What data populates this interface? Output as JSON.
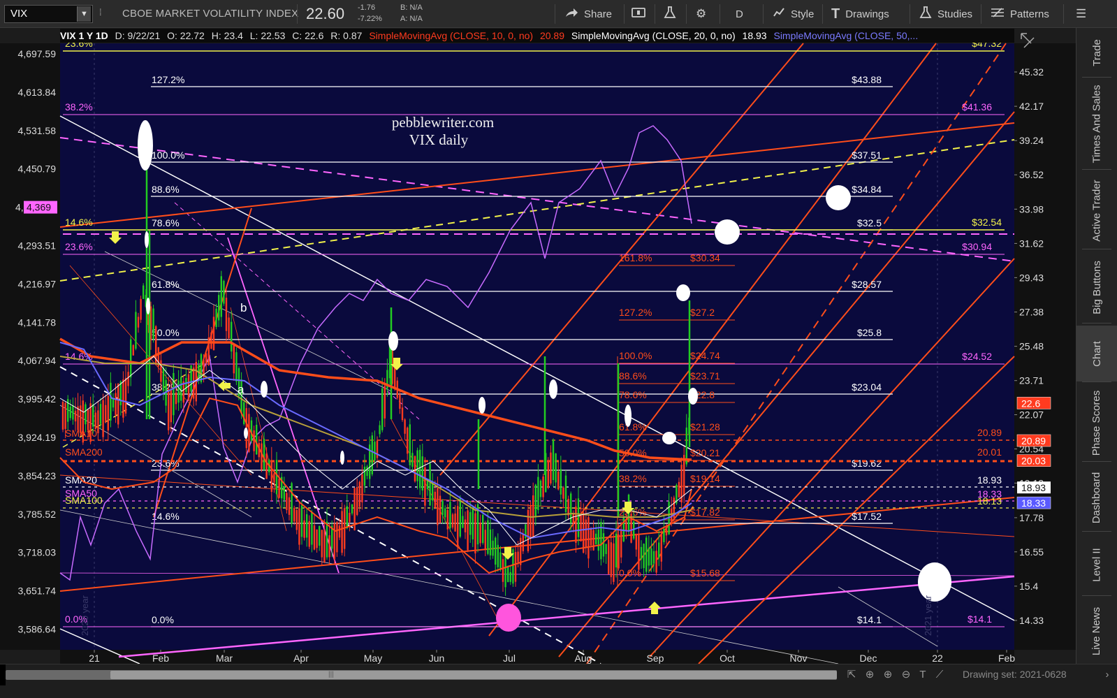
{
  "toolbar": {
    "symbol": "VIX",
    "title": "CBOE MARKET VOLATILITY INDEX",
    "price": "22.60",
    "change_abs": "-1.76",
    "change_pct": "-7.22%",
    "bid": "B: N/A",
    "ask": "A: N/A",
    "share_label": "Share",
    "period_label": "D",
    "style_label": "Style",
    "drawings_label": "Drawings",
    "studies_label": "Studies",
    "patterns_label": "Patterns"
  },
  "header": {
    "symbol_period": "VIX 1 Y 1D",
    "date": "D: 9/22/21",
    "open": "O: 22.72",
    "high": "H: 23.4",
    "low": "L: 22.53",
    "close": "C: 22.6",
    "range": "R: 0.87",
    "sma10_label": "SimpleMovingAvg (CLOSE, 10, 0, no)",
    "sma10_value": "20.89",
    "sma20_label": "SimpleMovingAvg (CLOSE, 20, 0, no)",
    "sma20_value": "18.93",
    "sma50_label": "SimpleMovingAvg (CLOSE, 50,..."
  },
  "colors": {
    "bg": "#0a0a3d",
    "orange": "#ff4d1a",
    "white": "#ffffff",
    "magenta": "#ff66ff",
    "yellow": "#f2f24a",
    "blue_sma50": "#6a6aff",
    "olive_sma100": "#b8a03a",
    "green": "#22cc22",
    "red": "#ff3b1f"
  },
  "left_axis": {
    "ticks": [
      "4,697.59",
      "4,613.84",
      "4,531.58",
      "4,450.79",
      "4,369",
      "4,293.51",
      "4,216.97",
      "4,141.78",
      "4,067.94",
      "3,995.42",
      "3,924.19",
      "3,854.23",
      "3,785.52",
      "3,718.03",
      "3,651.74",
      "3,586.64"
    ],
    "spx_tag_prefix": "4,",
    "spx_tag_value": "4,369"
  },
  "right_axis": {
    "ticks": [
      "45.32",
      "42.17",
      "39.24",
      "36.52",
      "33.98",
      "31.62",
      "29.43",
      "27.38",
      "25.48",
      "23.71",
      "22.07",
      "20.54",
      "19.12",
      "17.78",
      "16.55",
      "15.4",
      "14.33"
    ],
    "tag_close": "22.6",
    "tag_sma10": "20.89",
    "tag_sma200": "20.03",
    "tag_sma20": "18.93",
    "tag_sma50": "18.33"
  },
  "x_axis": {
    "labels": [
      "21",
      "Feb",
      "Mar",
      "Apr",
      "May",
      "Jun",
      "Jul",
      "Aug",
      "Sep",
      "Oct",
      "Nov",
      "Dec",
      "22",
      "Feb"
    ]
  },
  "annotations": {
    "watermark_line1": "pebblewriter.com",
    "watermark_line2": "VIX daily",
    "wave_b": "b",
    "wave_a": "a",
    "year_label_left": "2020 year",
    "year_label_right": "2021 year"
  },
  "fib_white": [
    {
      "pct": "127.2%",
      "value": "$43.88"
    },
    {
      "pct": "100.0%",
      "value": "$37.51"
    },
    {
      "pct": "88.6%",
      "value": "$34.84"
    },
    {
      "pct": "78.6%",
      "value": "$32.5"
    },
    {
      "pct": "61.8%",
      "value": "$28.57"
    },
    {
      "pct": "50.0%",
      "value": "$25.8"
    },
    {
      "pct": "38.2%",
      "value": "$23.04"
    },
    {
      "pct": "23.6%",
      "value": "$19.62"
    },
    {
      "pct": "14.6%",
      "value": "$17.52"
    },
    {
      "pct": "0.0%",
      "value": "$14.1"
    }
  ],
  "fib_magenta": [
    {
      "pct": "38.2%",
      "value": "$41.36"
    },
    {
      "pct": "23.6%",
      "value": "$30.94"
    },
    {
      "pct": "14.6%",
      "value": "$24.52"
    },
    {
      "pct": "0.0%",
      "value": "$14.1"
    }
  ],
  "fib_yellow": [
    {
      "pct": "23.6%",
      "value": "$47.32"
    },
    {
      "pct": "14.6%",
      "value": "$32.54"
    }
  ],
  "fib_orange": [
    {
      "pct": "161.8%",
      "value": "$30.34"
    },
    {
      "pct": "127.2%",
      "value": "$27.2"
    },
    {
      "pct": "100.0%",
      "value": "$24.74"
    },
    {
      "pct": "88.6%",
      "value": "$23.71"
    },
    {
      "pct": "78.6%",
      "value": "$22.8"
    },
    {
      "pct": "61.8%",
      "value": "$21.28"
    },
    {
      "pct": "50.0%",
      "value": "$20.21"
    },
    {
      "pct": "38.2%",
      "value": "$19.14"
    },
    {
      "pct": "23.6%",
      "value": "$17.82"
    },
    {
      "pct": "0.0%",
      "value": "$15.68"
    }
  ],
  "sma_labels": {
    "sma10": "SMA10",
    "sma200": "SMA200",
    "sma20": "SMA20",
    "sma50": "SMA50",
    "sma100": "SMA100"
  },
  "sma_right_values": {
    "sma10": "20.89",
    "sma200": "20.01",
    "sma20": "18.93",
    "sma50": "18.33",
    "sma100": "18.13"
  },
  "sidebar": {
    "tabs": [
      "Trade",
      "Times And Sales",
      "Active Trader",
      "Big Buttons",
      "Chart",
      "Phase Scores",
      "Dashboard",
      "Level II",
      "Live News"
    ],
    "active": "Chart"
  },
  "bottombar": {
    "drawing_set": "Drawing set: 2021-0628"
  }
}
